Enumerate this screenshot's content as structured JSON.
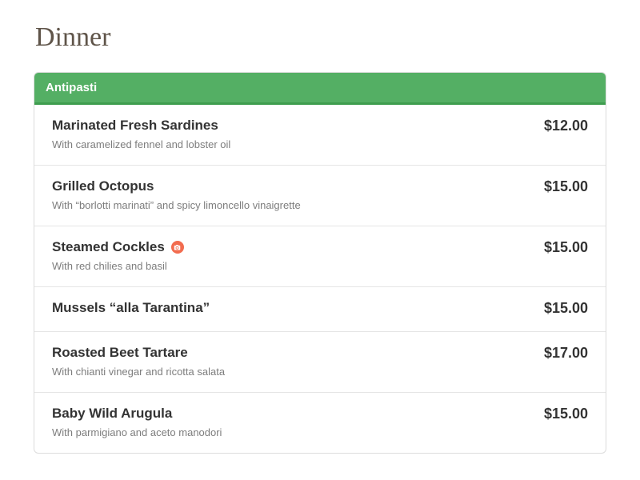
{
  "page_title": "Dinner",
  "section": {
    "title": "Antipasti",
    "items": [
      {
        "name": "Marinated Fresh Sardines",
        "desc": "With caramelized fennel and lobster oil",
        "price": "$12.00",
        "has_photo": false
      },
      {
        "name": "Grilled Octopus",
        "desc": "With “borlotti marinati” and spicy limoncello vinaigrette",
        "price": "$15.00",
        "has_photo": false
      },
      {
        "name": "Steamed Cockles",
        "desc": "With red chilies and basil",
        "price": "$15.00",
        "has_photo": true
      },
      {
        "name": "Mussels “alla Tarantina”",
        "desc": "",
        "price": "$15.00",
        "has_photo": false
      },
      {
        "name": "Roasted Beet Tartare",
        "desc": "With chianti vinegar and ricotta salata",
        "price": "$17.00",
        "has_photo": false
      },
      {
        "name": "Baby Wild Arugula",
        "desc": "With parmigiano and aceto manodori",
        "price": "$15.00",
        "has_photo": false
      }
    ]
  }
}
